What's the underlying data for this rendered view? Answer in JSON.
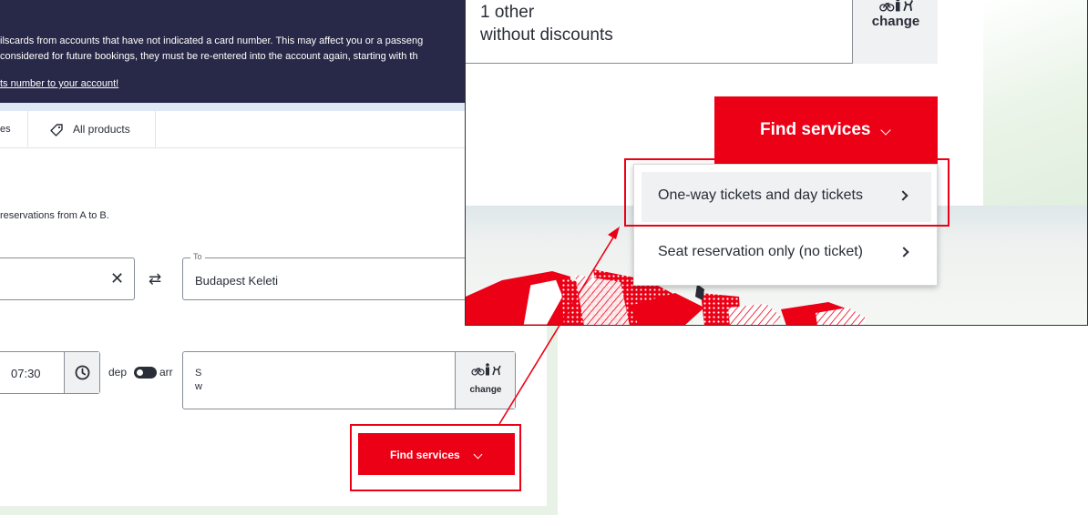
{
  "banner": {
    "line1": "ilscards from accounts that have not indicated a card number. This may affect you or a passeng",
    "line2": "considered for future bookings, they must be re-entered into the account again, starting with th",
    "link": "ts number to your account!"
  },
  "tabs": {
    "previous_label": "es",
    "all_products_label": "All products"
  },
  "search": {
    "description": "reservations from A to B.",
    "to_legend": "To",
    "to_value": "Budapest Keleti",
    "time_value": "07:30",
    "dep_label": "dep",
    "arr_label": "arr",
    "passenger_line1": "S",
    "passenger_line2": "w",
    "change_label": "change",
    "find_services_label": "Find services"
  },
  "popup": {
    "passenger_line1": "1 other",
    "passenger_line2": "without discounts",
    "change_label": "change",
    "find_services_label": "Find services",
    "menu_items": [
      {
        "label": "One-way tickets and day tickets"
      },
      {
        "label": "Seat reservation only (no ticket)"
      }
    ]
  },
  "colors": {
    "brand_red": "#ec0016",
    "banner_navy": "#282948",
    "text": "#282d37",
    "field_border": "#878c96",
    "button_grey": "#f0f1f2"
  },
  "icons": [
    "tag-icon",
    "close-icon",
    "swap-icon",
    "clock-icon",
    "passenger-options-icon",
    "chevron-down-icon",
    "chevron-right-icon"
  ]
}
